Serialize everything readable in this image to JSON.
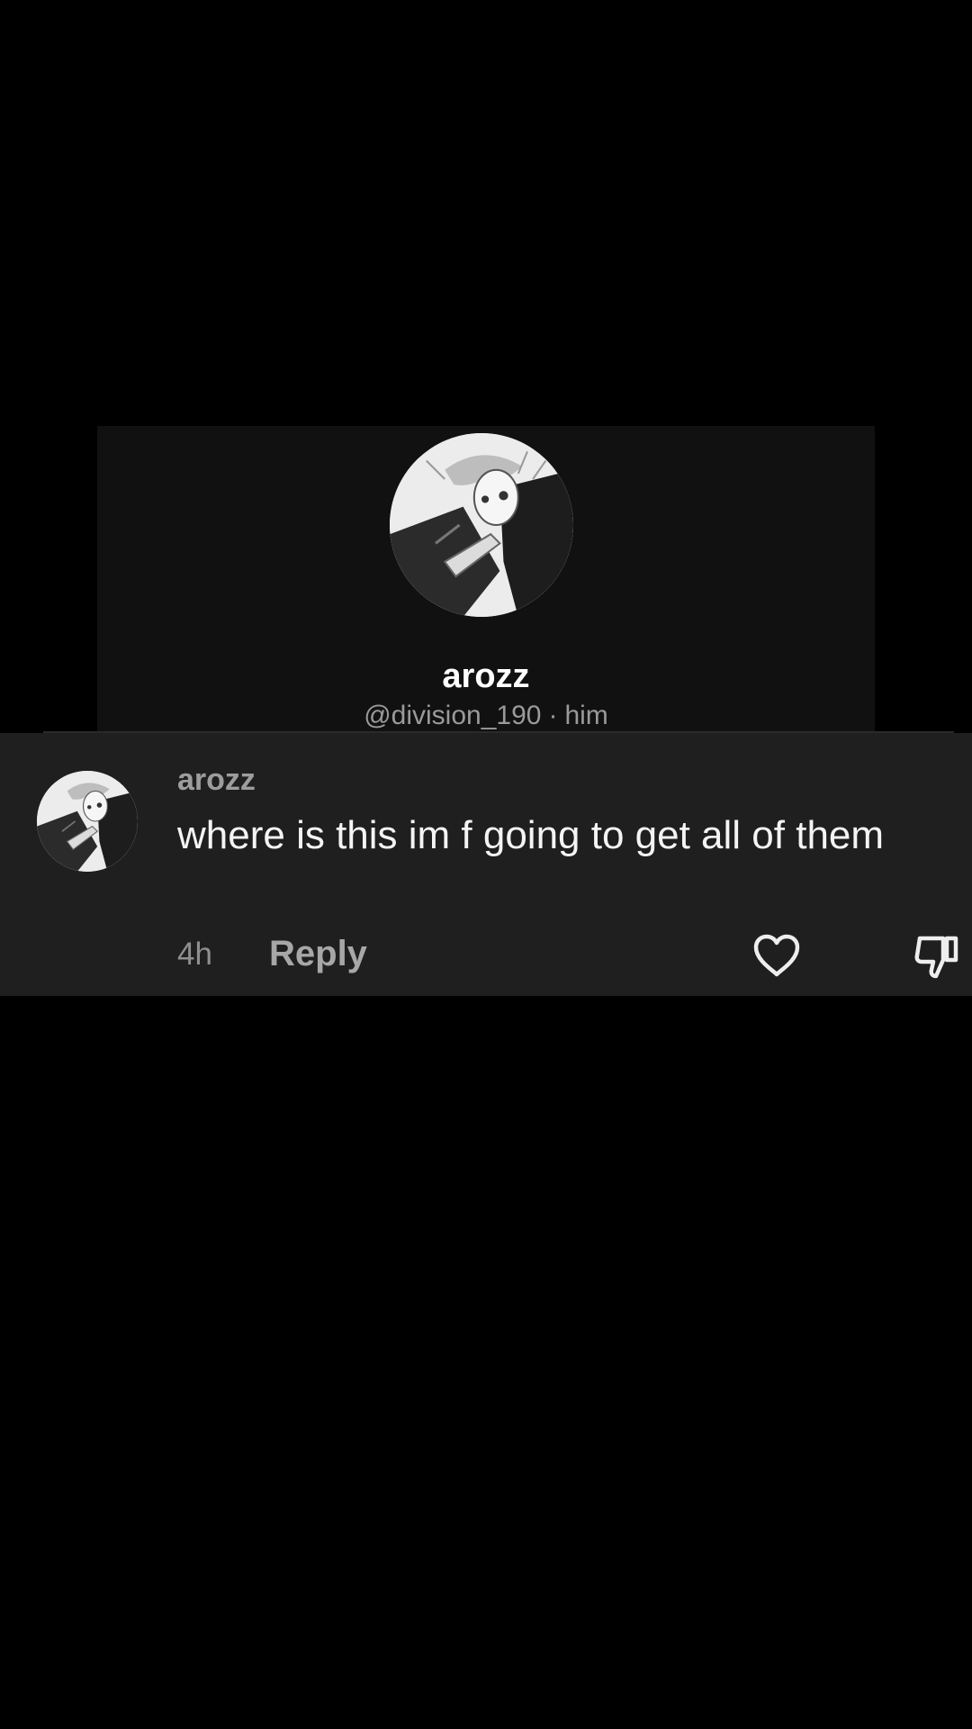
{
  "profile": {
    "display_name": "arozz",
    "handle": "@division_190",
    "separator": "·",
    "pronouns": "him",
    "avatar_icon": "anime-sketch-avatar-icon"
  },
  "comment": {
    "author": "arozz",
    "text": "where is this im f going to get all of them",
    "time": "4h",
    "reply_label": "Reply",
    "like_icon": "heart-outline-icon",
    "dislike_icon": "thumbs-down-outline-icon"
  },
  "colors": {
    "background": "#000000",
    "card": "#111111",
    "comment_panel": "#1f1f1f",
    "muted_text": "#9d9d9d",
    "primary_text": "#ffffff"
  }
}
